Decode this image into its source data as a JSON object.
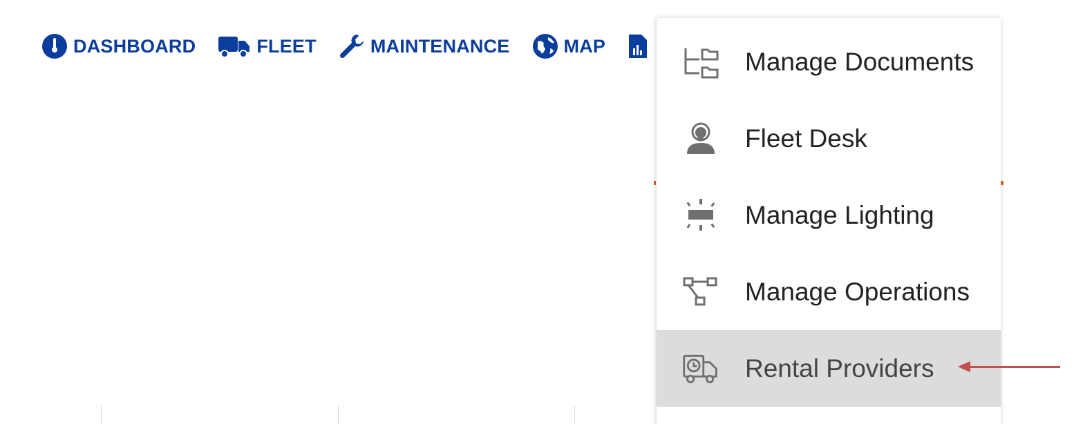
{
  "nav": {
    "items": [
      {
        "label": "DASHBOARD",
        "icon": "dashboard-gauge-icon"
      },
      {
        "label": "FLEET",
        "icon": "truck-icon"
      },
      {
        "label": "MAINTENANCE",
        "icon": "wrench-icon"
      },
      {
        "label": "MAP",
        "icon": "globe-icon"
      },
      {
        "label": "",
        "icon": "report-chart-icon"
      }
    ]
  },
  "dropdown": {
    "items": [
      {
        "label": "Manage Documents",
        "icon": "folder-tree-icon"
      },
      {
        "label": "Fleet Desk",
        "icon": "support-agent-icon"
      },
      {
        "label": "Manage Lighting",
        "icon": "light-panel-icon"
      },
      {
        "label": "Manage Operations",
        "icon": "workflow-icon"
      },
      {
        "label": "Rental Providers",
        "icon": "rental-truck-clock-icon",
        "active": true
      }
    ]
  },
  "colors": {
    "nav_blue": "#0b3d9c",
    "menu_icon_gray": "#6f6f6f",
    "active_row_bg": "#dcdcdc",
    "annotation_arrow": "#c0504d",
    "accent_orange": "#d9642b"
  }
}
